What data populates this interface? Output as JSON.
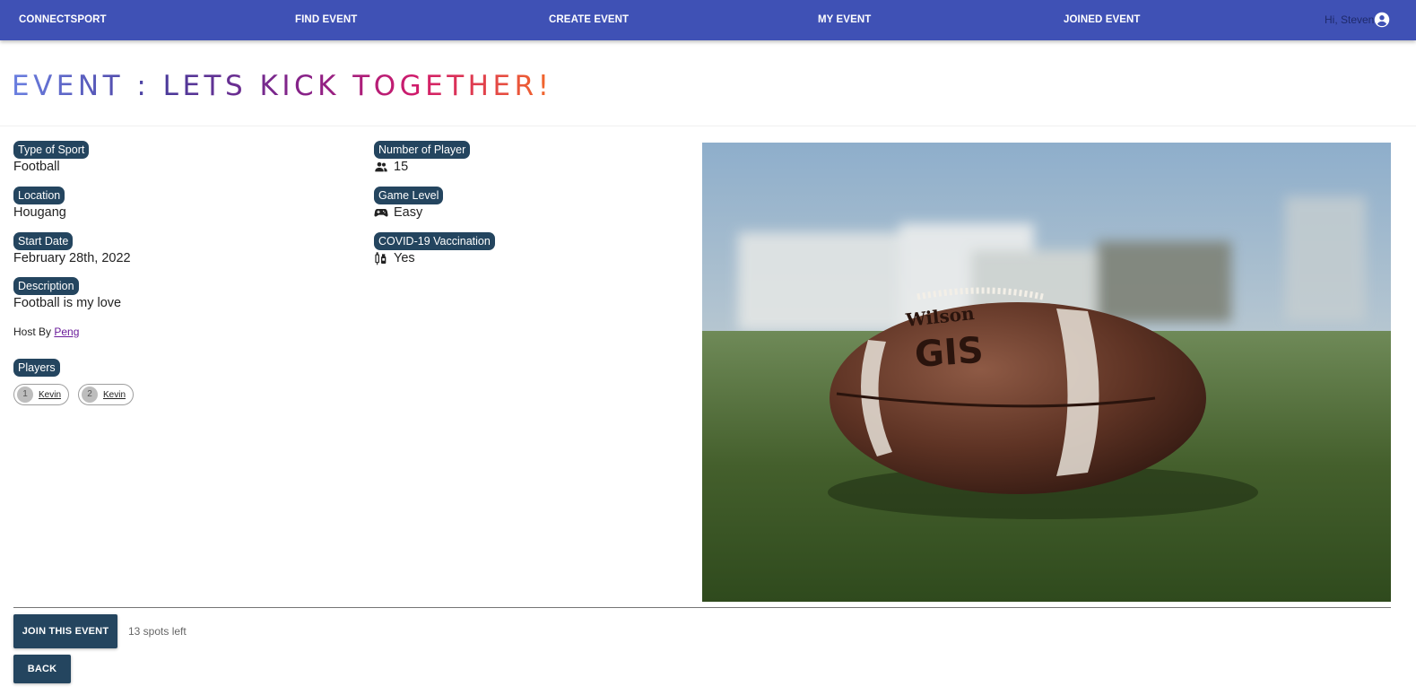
{
  "nav": {
    "brand": "CONNECTSPORT",
    "find_event": "FIND EVENT",
    "create_event": "CREATE EVENT",
    "my_event": "MY EVENT",
    "joined_event": "JOINED EVENT",
    "greeting": "Hi, Steven",
    "user_icon": "account-circle-icon"
  },
  "title": {
    "prefix": "EVENT : ",
    "name": "LETS KICK TOGETHER!"
  },
  "details": {
    "sport_label": "Type of Sport",
    "sport_value": "Football",
    "location_label": "Location",
    "location_value": "Hougang",
    "start_date_label": "Start Date",
    "start_date_value": "February 28th, 2022",
    "description_label": "Description",
    "description_value": "Football is my love",
    "players_count_label": "Number of Player",
    "players_count_value": "15",
    "game_level_label": "Game Level",
    "game_level_value": "Easy",
    "vaccination_label": "COVID-19 Vaccination",
    "vaccination_value": "Yes"
  },
  "host": {
    "prefix": "Host By ",
    "name": "Peng"
  },
  "players": {
    "label": "Players",
    "list": [
      {
        "num": "1",
        "name": "Kevin"
      },
      {
        "num": "2",
        "name": "Kevin"
      }
    ]
  },
  "actions": {
    "join_label": "JOIN THIS EVENT",
    "spots_left": "13 spots left",
    "back_label": "BACK"
  },
  "colors": {
    "navbar": "#3f51b5",
    "chip": "#24455f",
    "button": "#24455f",
    "host_link": "#6a1b9a"
  }
}
